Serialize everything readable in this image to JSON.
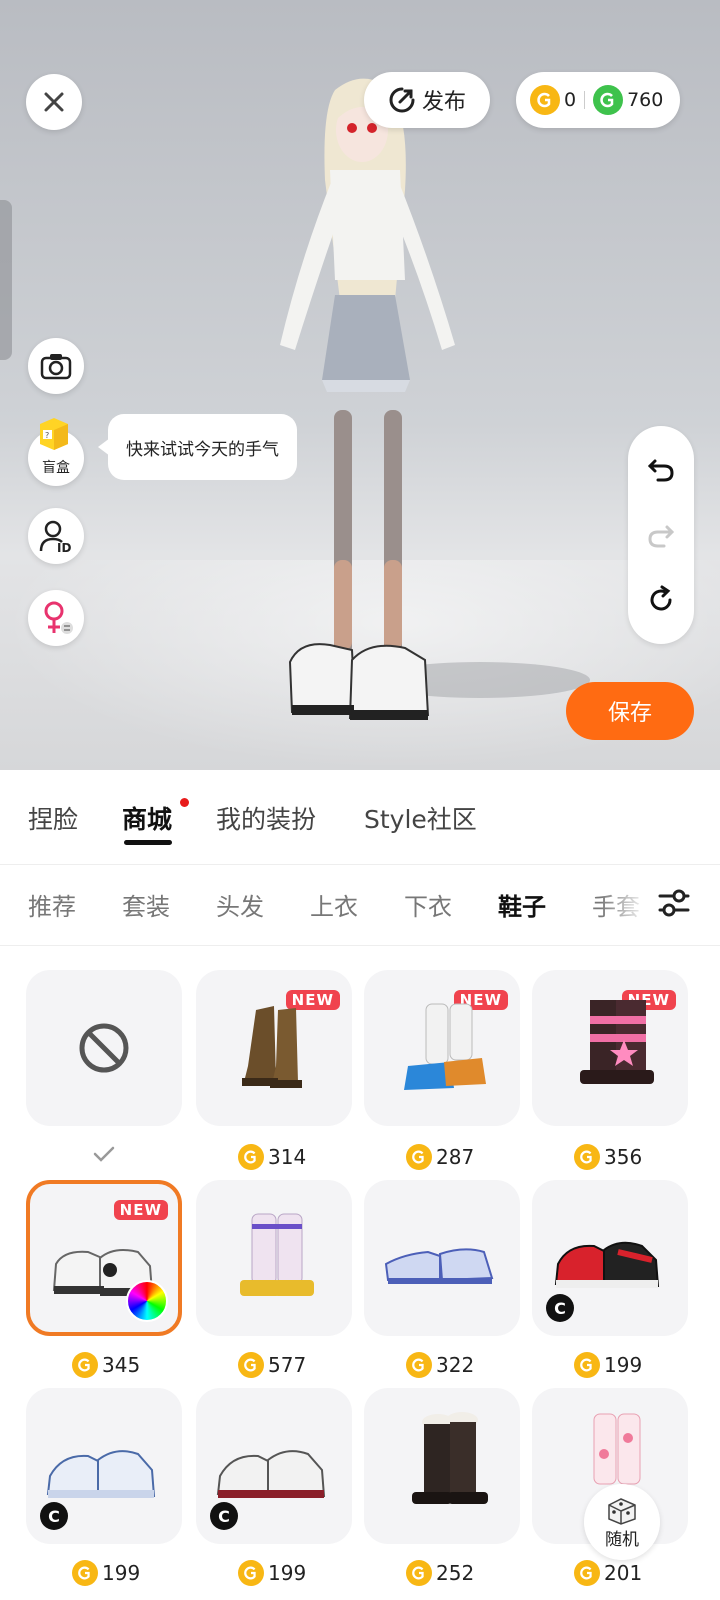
{
  "top": {
    "publish_label": "发布",
    "coin_gold": "0",
    "coin_green": "760"
  },
  "left_tools": {
    "blindbox_label": "盲盒",
    "bubble_text": "快来试试今天的手气"
  },
  "save_label": "保存",
  "main_tabs": [
    "捏脸",
    "商城",
    "我的装扮",
    "Style社区"
  ],
  "category_tabs": [
    "推荐",
    "套装",
    "头发",
    "上衣",
    "下衣",
    "鞋子",
    "手套"
  ],
  "new_badge": "NEW",
  "c_badge": "C",
  "items": [
    {
      "price": ""
    },
    {
      "price": "314"
    },
    {
      "price": "287"
    },
    {
      "price": "356"
    },
    {
      "price": "345"
    },
    {
      "price": "577"
    },
    {
      "price": "322"
    },
    {
      "price": "199"
    },
    {
      "price": "199"
    },
    {
      "price": "199"
    },
    {
      "price": "252"
    },
    {
      "price": "201"
    }
  ],
  "random_label": "随机",
  "colors": {
    "accent": "#ff6b12",
    "gold_coin": "#f8b714",
    "green_coin": "#3ec24c",
    "new_badge": "#f0434e",
    "selected_border": "#f07a24"
  }
}
